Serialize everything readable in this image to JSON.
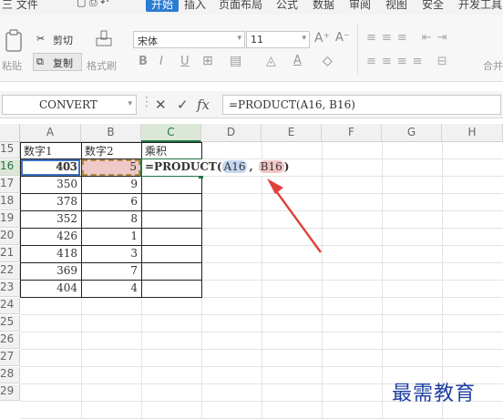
{
  "menu": {
    "file": "三 文件",
    "tabs": [
      "开始",
      "插入",
      "页面布局",
      "公式",
      "数据",
      "审阅",
      "视图",
      "安全",
      "开发工具"
    ]
  },
  "ribbon": {
    "cut": "剪切",
    "paste": "粘贴",
    "copy": "复制",
    "format_painter": "格式刷",
    "font_name": "宋体",
    "font_size": "11",
    "right_partial": "合并"
  },
  "formula_bar": {
    "name_box": "CONVERT",
    "cancel": "✕",
    "confirm": "✓",
    "fx": "fx",
    "formula": "=PRODUCT(A16, B16)"
  },
  "columns": [
    "A",
    "B",
    "C",
    "D",
    "E",
    "F",
    "G",
    "H"
  ],
  "rows": [
    "15",
    "16",
    "17",
    "18",
    "19",
    "20",
    "21",
    "22",
    "23",
    "24",
    "25",
    "26",
    "27",
    "28",
    "29"
  ],
  "table": {
    "headers": [
      "数字1",
      "数字2",
      "乘积"
    ],
    "data": [
      [
        "403",
        "5"
      ],
      [
        "350",
        "9"
      ],
      [
        "378",
        "6"
      ],
      [
        "352",
        "8"
      ],
      [
        "426",
        "1"
      ],
      [
        "418",
        "3"
      ],
      [
        "369",
        "7"
      ],
      [
        "404",
        "4"
      ]
    ]
  },
  "editing_cell": {
    "func": "=PRODUCT(",
    "ref1": "A16",
    "sep": ",",
    "ref2": "B16",
    "close": ")"
  },
  "colors": {
    "ref1": "#c5d7f0",
    "ref2": "#f2c6c6",
    "selection": "#217346",
    "arrow": "#e0403a"
  },
  "watermark": "最需教育"
}
